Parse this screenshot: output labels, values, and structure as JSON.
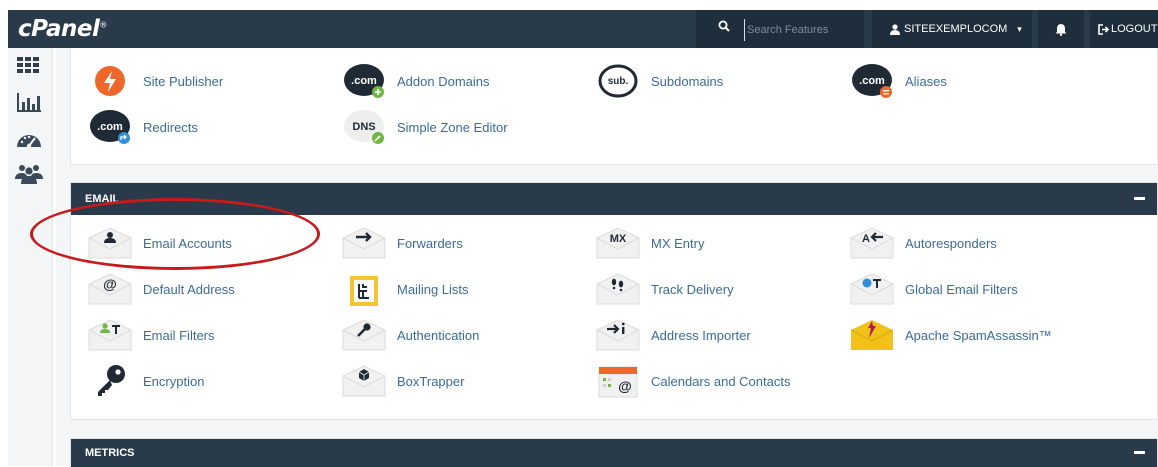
{
  "header": {
    "logo": "cPanel",
    "logo_mark": "®",
    "search": {
      "placeholder": "Search Features",
      "value": ""
    },
    "user": {
      "name": "SITEEXEMPLOCOM"
    },
    "logout_label": "LOGOUT"
  },
  "sidebar": {
    "items": [
      {
        "name": "grid-icon"
      },
      {
        "name": "bar-chart-icon"
      },
      {
        "name": "dashboard-gauge-icon"
      },
      {
        "name": "users-icon"
      }
    ]
  },
  "domains": {
    "items": [
      {
        "label": "Site Publisher",
        "icon": "lightning-icon"
      },
      {
        "label": "Addon Domains",
        "icon": "addon-domain-icon"
      },
      {
        "label": "Subdomains",
        "icon": "subdomain-icon"
      },
      {
        "label": "Aliases",
        "icon": "alias-icon"
      },
      {
        "label": "Redirects",
        "icon": "redirect-icon"
      },
      {
        "label": "Simple Zone Editor",
        "icon": "dns-icon"
      }
    ]
  },
  "email": {
    "title": "EMAIL",
    "items": [
      {
        "label": "Email Accounts",
        "icon": "email-account-icon"
      },
      {
        "label": "Forwarders",
        "icon": "forwarder-icon"
      },
      {
        "label": "MX Entry",
        "icon": "mx-entry-icon"
      },
      {
        "label": "Autoresponders",
        "icon": "autoresponder-icon"
      },
      {
        "label": "Default Address",
        "icon": "at-sign-icon"
      },
      {
        "label": "Mailing Lists",
        "icon": "mailing-list-icon"
      },
      {
        "label": "Track Delivery",
        "icon": "footsteps-icon"
      },
      {
        "label": "Global Email Filters",
        "icon": "global-filter-icon"
      },
      {
        "label": "Email Filters",
        "icon": "email-filter-icon"
      },
      {
        "label": "Authentication",
        "icon": "key-envelope-icon"
      },
      {
        "label": "Address Importer",
        "icon": "address-importer-icon"
      },
      {
        "label": "Apache SpamAssassin™",
        "icon": "spamassassin-icon"
      },
      {
        "label": "Encryption",
        "icon": "key-icon"
      },
      {
        "label": "BoxTrapper",
        "icon": "boxtrapper-icon"
      },
      {
        "label": "Calendars and Contacts",
        "icon": "calendar-icon"
      }
    ]
  },
  "metrics": {
    "title": "METRICS"
  },
  "colors": {
    "header_bg": "#293a4a",
    "link": "#3b6b9a",
    "highlight": "#c81a1a",
    "orange": "#f0672a",
    "green": "#6fb544",
    "blue": "#2f8fd8"
  }
}
